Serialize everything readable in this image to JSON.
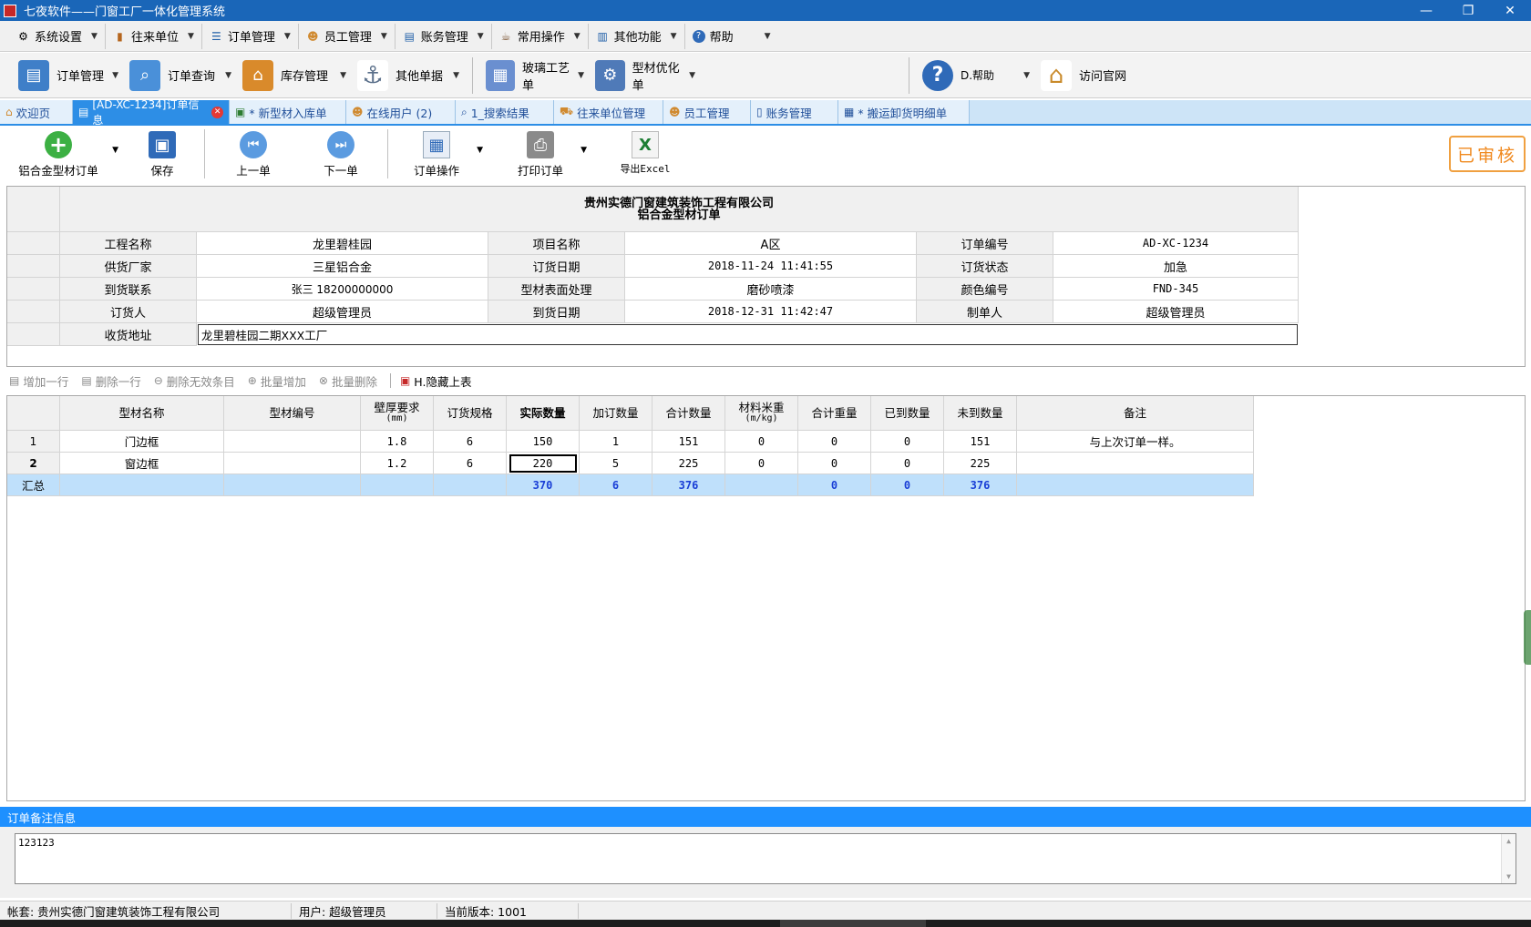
{
  "window": {
    "title": "七夜软件——门窗工厂一体化管理系统",
    "controls": [
      "—",
      "❐",
      "✕"
    ]
  },
  "menu": [
    {
      "label": "系统设置",
      "icon": "gear-icon"
    },
    {
      "label": "往来单位",
      "icon": "book-icon"
    },
    {
      "label": "订单管理",
      "icon": "list-icon"
    },
    {
      "label": "员工管理",
      "icon": "users-icon"
    },
    {
      "label": "账务管理",
      "icon": "ledger-icon"
    },
    {
      "label": "常用操作",
      "icon": "cup-icon"
    },
    {
      "label": "其他功能",
      "icon": "doc-icon"
    },
    {
      "label": "帮助",
      "icon": "help-icon"
    }
  ],
  "bigbar": [
    {
      "label": "订单管理",
      "icon": "order-icon",
      "color": "#3f7fc8"
    },
    {
      "label": "订单查询",
      "icon": "search-doc-icon",
      "color": "#4a90d9"
    },
    {
      "label": "库存管理",
      "icon": "warehouse-icon",
      "color": "#d98a2b"
    },
    {
      "label": "其他单据",
      "icon": "anchor-icon",
      "color": "#5a6f8a"
    },
    {
      "label": "玻璃工艺单",
      "icon": "grid-icon",
      "color": "#6a8fd0"
    },
    {
      "label": "型材优化单",
      "icon": "gear-sheet-icon",
      "color": "#4f7ab8"
    },
    {
      "label": "D.帮助",
      "icon": "question-icon",
      "color": "#2f6ab8"
    },
    {
      "label": "访问官网",
      "icon": "house-icon",
      "color": "#c98a2a"
    }
  ],
  "tabs": [
    {
      "label": "欢迎页",
      "icon": "home-icon",
      "active": false
    },
    {
      "label": "[AD-XC-1234]订单信息",
      "icon": "doc-icon",
      "active": true
    },
    {
      "label": "* 新型材入库单",
      "icon": "doc-add-icon",
      "active": false
    },
    {
      "label": "在线用户 (2)",
      "icon": "users-icon",
      "active": false
    },
    {
      "label": "1_搜索结果",
      "icon": "search-icon",
      "active": false
    },
    {
      "label": "往来单位管理",
      "icon": "truck-icon",
      "active": false
    },
    {
      "label": "员工管理",
      "icon": "users-icon",
      "active": false
    },
    {
      "label": "账务管理",
      "icon": "ledger-icon",
      "active": false
    },
    {
      "label": "* 搬运卸货明细单",
      "icon": "table-icon",
      "active": false
    }
  ],
  "actions": {
    "new_order": "铝合金型材订单",
    "save": "保存",
    "prev": "上一单",
    "next": "下一单",
    "order_ops": "订单操作",
    "print": "打印订单",
    "export": "导出Excel",
    "stamp": "已审核"
  },
  "form": {
    "company": "贵州实德门窗建筑装饰工程有限公司",
    "subtitle": "铝合金型材订单",
    "rows": [
      [
        {
          "label": "工程名称",
          "value": "龙里碧桂园"
        },
        {
          "label": "项目名称",
          "value": "A区"
        },
        {
          "label": "订单编号",
          "value": "AD-XC-1234"
        }
      ],
      [
        {
          "label": "供货厂家",
          "value": "三星铝合金"
        },
        {
          "label": "订货日期",
          "value": "2018-11-24 11:41:55"
        },
        {
          "label": "订货状态",
          "value": "加急"
        }
      ],
      [
        {
          "label": "到货联系",
          "value": "张三 18200000000"
        },
        {
          "label": "型材表面处理",
          "value": "磨砂喷漆"
        },
        {
          "label": "颜色编号",
          "value": "FND-345"
        }
      ],
      [
        {
          "label": "订货人",
          "value": "超级管理员"
        },
        {
          "label": "到货日期",
          "value": "2018-12-31 11:42:47"
        },
        {
          "label": "制单人",
          "value": "超级管理员"
        }
      ]
    ],
    "address_label": "收货地址",
    "address_value": "龙里碧桂园二期XXX工厂"
  },
  "linebar": [
    {
      "label": "增加一行",
      "icon": "add-row-icon",
      "enabled": false
    },
    {
      "label": "删除一行",
      "icon": "delete-row-icon",
      "enabled": false
    },
    {
      "label": "删除无效条目",
      "icon": "minus-circle-icon",
      "enabled": false
    },
    {
      "label": "批量增加",
      "icon": "plus-circle-icon",
      "enabled": false
    },
    {
      "label": "批量删除",
      "icon": "x-circle-icon",
      "enabled": false
    },
    {
      "label": "H.隐藏上表",
      "icon": "hide-table-icon",
      "enabled": true
    }
  ],
  "grid": {
    "headers": [
      {
        "label": "型材名称"
      },
      {
        "label": "型材编号"
      },
      {
        "label": "壁厚要求",
        "sub": "(mm)"
      },
      {
        "label": "订货规格"
      },
      {
        "label": "实际数量",
        "bold": true
      },
      {
        "label": "加订数量"
      },
      {
        "label": "合计数量"
      },
      {
        "label": "材料米重",
        "sub": "(m/kg)"
      },
      {
        "label": "合计重量"
      },
      {
        "label": "已到数量"
      },
      {
        "label": "未到数量"
      },
      {
        "label": "备注"
      }
    ],
    "rows": [
      {
        "no": "1",
        "cells": [
          "门边框",
          "",
          "1.8",
          "6",
          "150",
          "1",
          "151",
          "0",
          "0",
          "0",
          "151",
          "与上次订单一样。"
        ]
      },
      {
        "no": "2",
        "cells": [
          "窗边框",
          "",
          "1.2",
          "6",
          "220",
          "5",
          "225",
          "0",
          "0",
          "0",
          "225",
          ""
        ]
      }
    ],
    "summary": {
      "label": "汇总",
      "cells": [
        "",
        "",
        "",
        "",
        "370",
        "6",
        "376",
        "",
        "0",
        "0",
        "376",
        ""
      ]
    }
  },
  "remarks": {
    "title": "订单备注信息",
    "value": "123123"
  },
  "status": {
    "account": "帐套: 贵州实德门窗建筑装饰工程有限公司",
    "user": "用户: 超级管理员",
    "version": "当前版本: 1001"
  }
}
